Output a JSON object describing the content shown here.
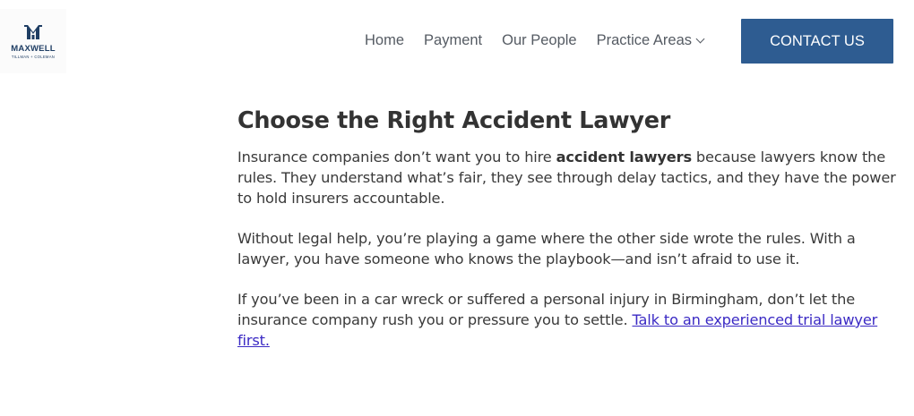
{
  "logo": {
    "name": "MAXWELL",
    "sub": "TILLMAN + COLEMAN",
    "color": "#1f3e64"
  },
  "nav": {
    "items": [
      {
        "label": "Home"
      },
      {
        "label": "Payment"
      },
      {
        "label": "Our People"
      },
      {
        "label": "Practice Areas",
        "has_dropdown": true
      }
    ],
    "contact_label": "CONTACT US",
    "contact_color": "#2e5c91"
  },
  "article": {
    "title": "Choose the Right Accident Lawyer",
    "p1_before": "Insurance companies don’t want you to hire ",
    "p1_bold": "accident lawyers",
    "p1_after": " because lawyers know the rules. They understand what’s fair, they see through delay tactics, and they have the power to hold insurers accountable.",
    "p2": "Without legal help, you’re playing a game where the other side wrote the rules. With a lawyer, you have someone who knows the playbook—and isn’t afraid to use it.",
    "p3_before": "If you’ve been in a car wreck or suffered a personal injury in Birmingham, don’t let the insurance company rush you or pressure you to settle. ",
    "p3_link": "Talk to an experienced trial lawyer first.",
    "link_color": "#3b2ac4"
  }
}
